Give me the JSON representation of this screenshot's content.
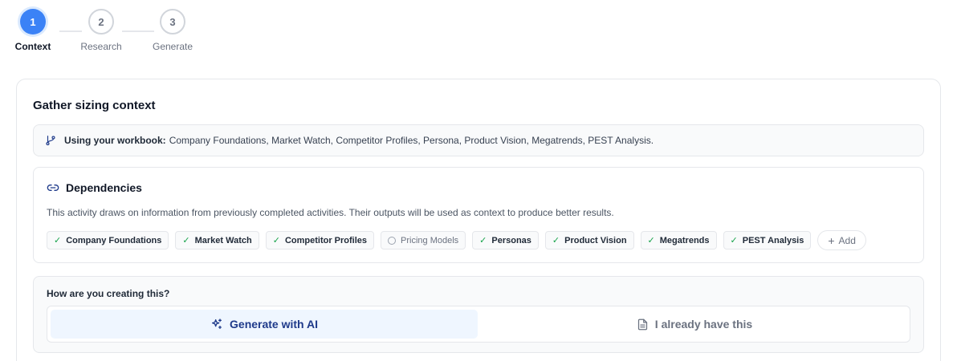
{
  "stepper": {
    "steps": [
      {
        "number": "1",
        "label": "Context",
        "state": "active"
      },
      {
        "number": "2",
        "label": "Research",
        "state": "inactive"
      },
      {
        "number": "3",
        "label": "Generate",
        "state": "inactive"
      }
    ]
  },
  "card": {
    "title": "Gather sizing context",
    "workbook": {
      "icon": "git-branch-icon",
      "label": "Using your workbook:",
      "items": "Company Foundations, Market Watch, Competitor Profiles, Persona, Product Vision, Megatrends, PEST Analysis."
    },
    "dependencies": {
      "icon": "link-icon",
      "title": "Dependencies",
      "description": "This activity draws on information from previously completed activities. Their outputs will be used as context to produce better results.",
      "chips": [
        {
          "label": "Company Foundations",
          "done": true
        },
        {
          "label": "Market Watch",
          "done": true
        },
        {
          "label": "Competitor Profiles",
          "done": true
        },
        {
          "label": "Pricing Models",
          "done": false
        },
        {
          "label": "Personas",
          "done": true
        },
        {
          "label": "Product Vision",
          "done": true
        },
        {
          "label": "Megatrends",
          "done": true
        },
        {
          "label": "PEST Analysis",
          "done": true
        }
      ],
      "add_label": "Add"
    },
    "method": {
      "question": "How are you creating this?",
      "options": [
        {
          "label": "Generate with AI",
          "icon": "sparkles-icon",
          "selected": true
        },
        {
          "label": "I already have this",
          "icon": "document-icon",
          "selected": false
        }
      ]
    }
  },
  "colors": {
    "accent": "#3b82f6",
    "check": "#16a34a",
    "selected_bg": "#eff6ff"
  }
}
